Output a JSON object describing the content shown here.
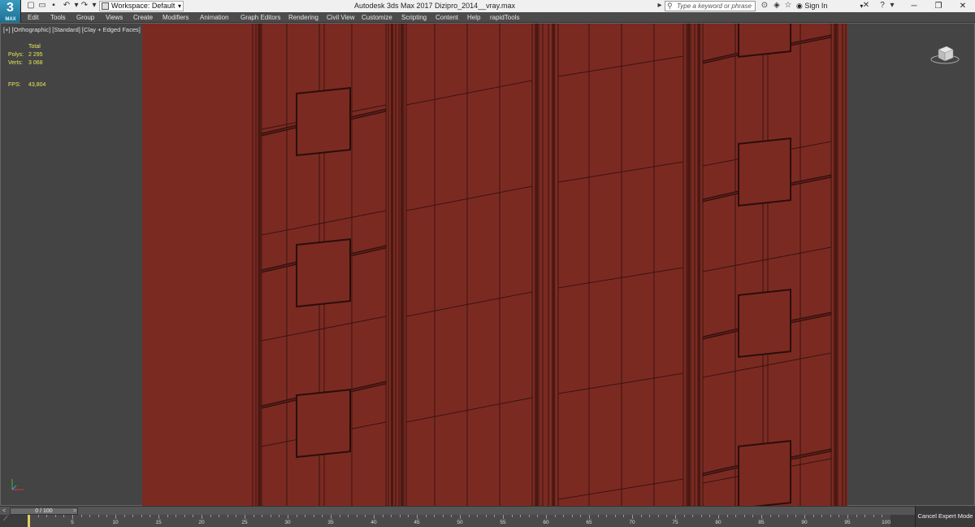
{
  "app": {
    "logo_main": "3",
    "logo_sub": "MAX",
    "workspace_label": "Workspace: Default",
    "title": "Autodesk 3ds Max 2017     Dizipro_2014__vray.max",
    "search_placeholder": "Type a keyword or phrase",
    "signin_label": "Sign In"
  },
  "menu": [
    "Edit",
    "Tools",
    "Group",
    "Views",
    "Create",
    "Modifiers",
    "Animation",
    "Graph Editors",
    "Rendering",
    "Civil View",
    "Customize",
    "Scripting",
    "Content",
    "Help",
    "rapidTools"
  ],
  "viewport": {
    "label": "[+] [Orthographic] [Standard] [Clay + Edged Faces]",
    "stats": {
      "total_label": "Total",
      "polys_label": "Polys:",
      "polys_value": "2 295",
      "verts_label": "Verts:",
      "verts_value": "3 068",
      "fps_label": "FPS:",
      "fps_value": "43,804"
    }
  },
  "timeline": {
    "slider_label": "0 / 100",
    "ticks": [
      "5",
      "10",
      "15",
      "20",
      "25",
      "30",
      "35",
      "40",
      "45",
      "50",
      "55",
      "60",
      "65",
      "70",
      "75",
      "80",
      "85",
      "90",
      "95",
      "100"
    ],
    "cancel_expert_label": "Cancel Expert Mode"
  },
  "colors": {
    "viewport_bg": "#444444",
    "model_fill": "#7b2a22",
    "model_edge": "#3a1410",
    "stats_text": "#e8e85a",
    "menu_bg": "#4b4b4b",
    "title_bg": "#f0f0f0"
  }
}
